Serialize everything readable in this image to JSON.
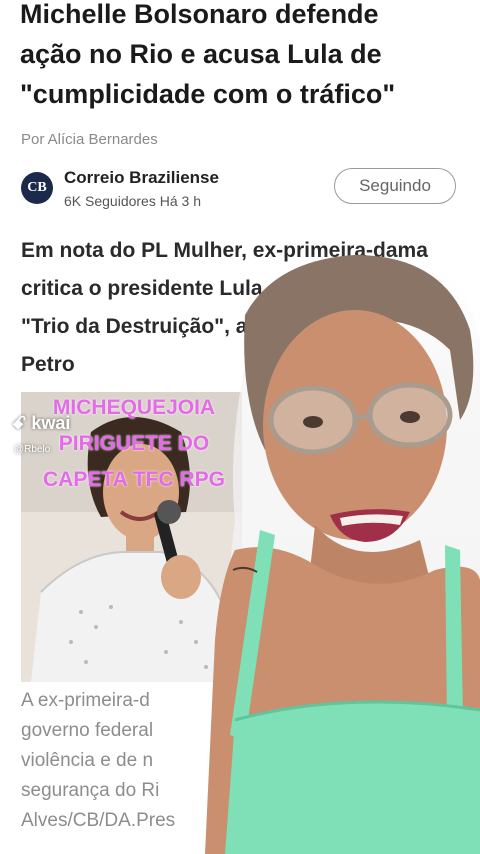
{
  "article": {
    "headline_lines": [
      "Michelle Bolsonaro defende",
      "ação no Rio e acusa Lula de",
      "\"cumplicidade com o tráfico\""
    ],
    "byline": "Por Alícia Bernardes",
    "source": {
      "logo_text": "CB",
      "name": "Correio Braziliense",
      "meta": "6K Seguidores Há 3 h",
      "follow_label": "Seguindo"
    },
    "summary_lines": [
      "Em nota do PL Mulher, ex-primeira-dama",
      "critica o presidente Lula",
      "\"Trio da Destruição\", a",
      "Petro"
    ],
    "caption_lines": [
      "A ex-primeira-d",
      "governo federal",
      "violência e de n",
      "segurança do Ri",
      "Alves/CB/DA.Pres"
    ]
  },
  "overlay": {
    "lines": [
      "MICHEQUEJOIA",
      "PIRIGUETE DO",
      "CAPETA TFC RPG"
    ],
    "kwai_label": "kwai",
    "kwai_handle": "@Rbelo"
  },
  "colors": {
    "overlay_text": "#e46be8",
    "shirt": "#7fe0b8",
    "logo_bg": "#1b2a4a"
  }
}
